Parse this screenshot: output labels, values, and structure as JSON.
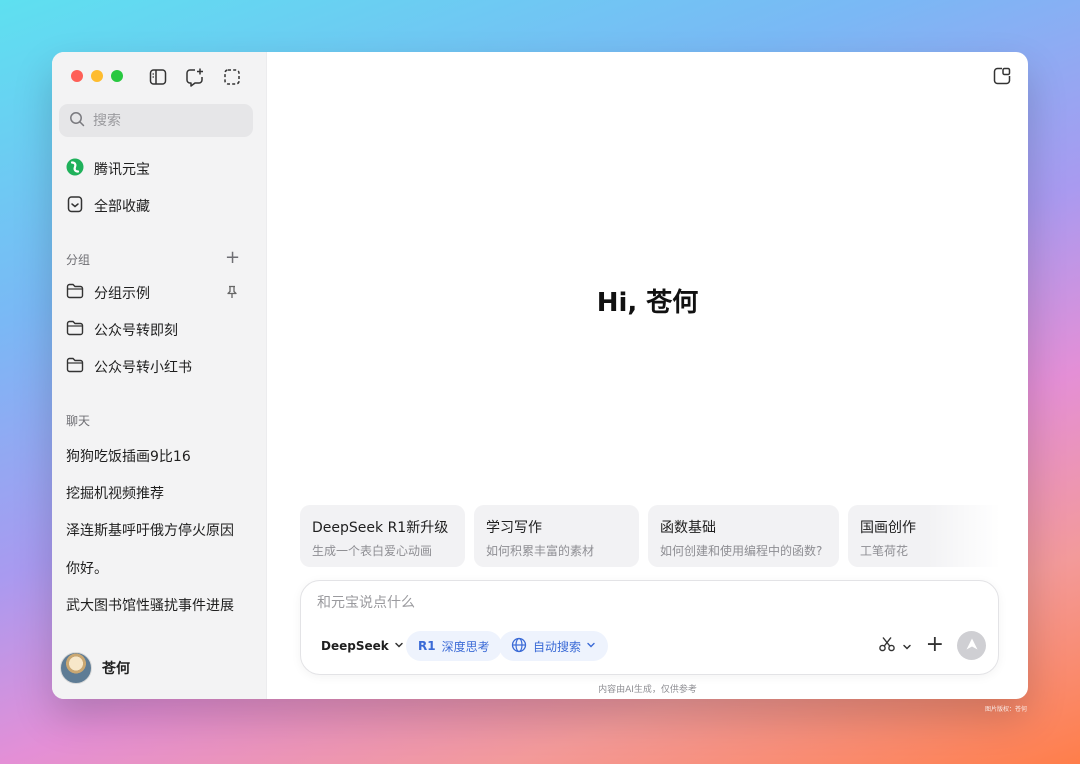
{
  "sidebar": {
    "search_placeholder": "搜索",
    "nav": [
      {
        "label": "腾讯元宝",
        "icon": "yuanbao-logo-icon"
      },
      {
        "label": "全部收藏",
        "icon": "bookmark-icon"
      }
    ],
    "groups_title": "分组",
    "groups": [
      {
        "label": "分组示例",
        "pinned": true
      },
      {
        "label": "公众号转即刻"
      },
      {
        "label": "公众号转小红书"
      }
    ],
    "chats_title": "聊天",
    "chats": [
      "狗狗吃饭插画9比16",
      "挖掘机视频推荐",
      "泽连斯基呼吁俄方停火原因",
      "你好。",
      "武大图书馆性骚扰事件进展"
    ],
    "user_name": "苍何"
  },
  "main": {
    "greeting": "Hi, 苍何",
    "cards": [
      {
        "title": "DeepSeek R1新升级",
        "subtitle": "生成一个表白爱心动画"
      },
      {
        "title": "学习写作",
        "subtitle": "如何积累丰富的素材"
      },
      {
        "title": "函数基础",
        "subtitle": "如何创建和使用编程中的函数?"
      },
      {
        "title": "国画创作",
        "subtitle": "工笔荷花"
      }
    ],
    "composer": {
      "placeholder": "和元宝说点什么",
      "model": "DeepSeek",
      "deep_think": "深度思考",
      "deep_think_icon": "R1",
      "auto_search": "自动搜索"
    },
    "disclaimer": "内容由AI生成，仅供参考"
  },
  "watermark": "图片版权：苍何",
  "colors": {
    "accent_blue": "#3a6ad6",
    "logo_green": "#1fb15b",
    "sidebar_bg": "#f3f3f4"
  }
}
